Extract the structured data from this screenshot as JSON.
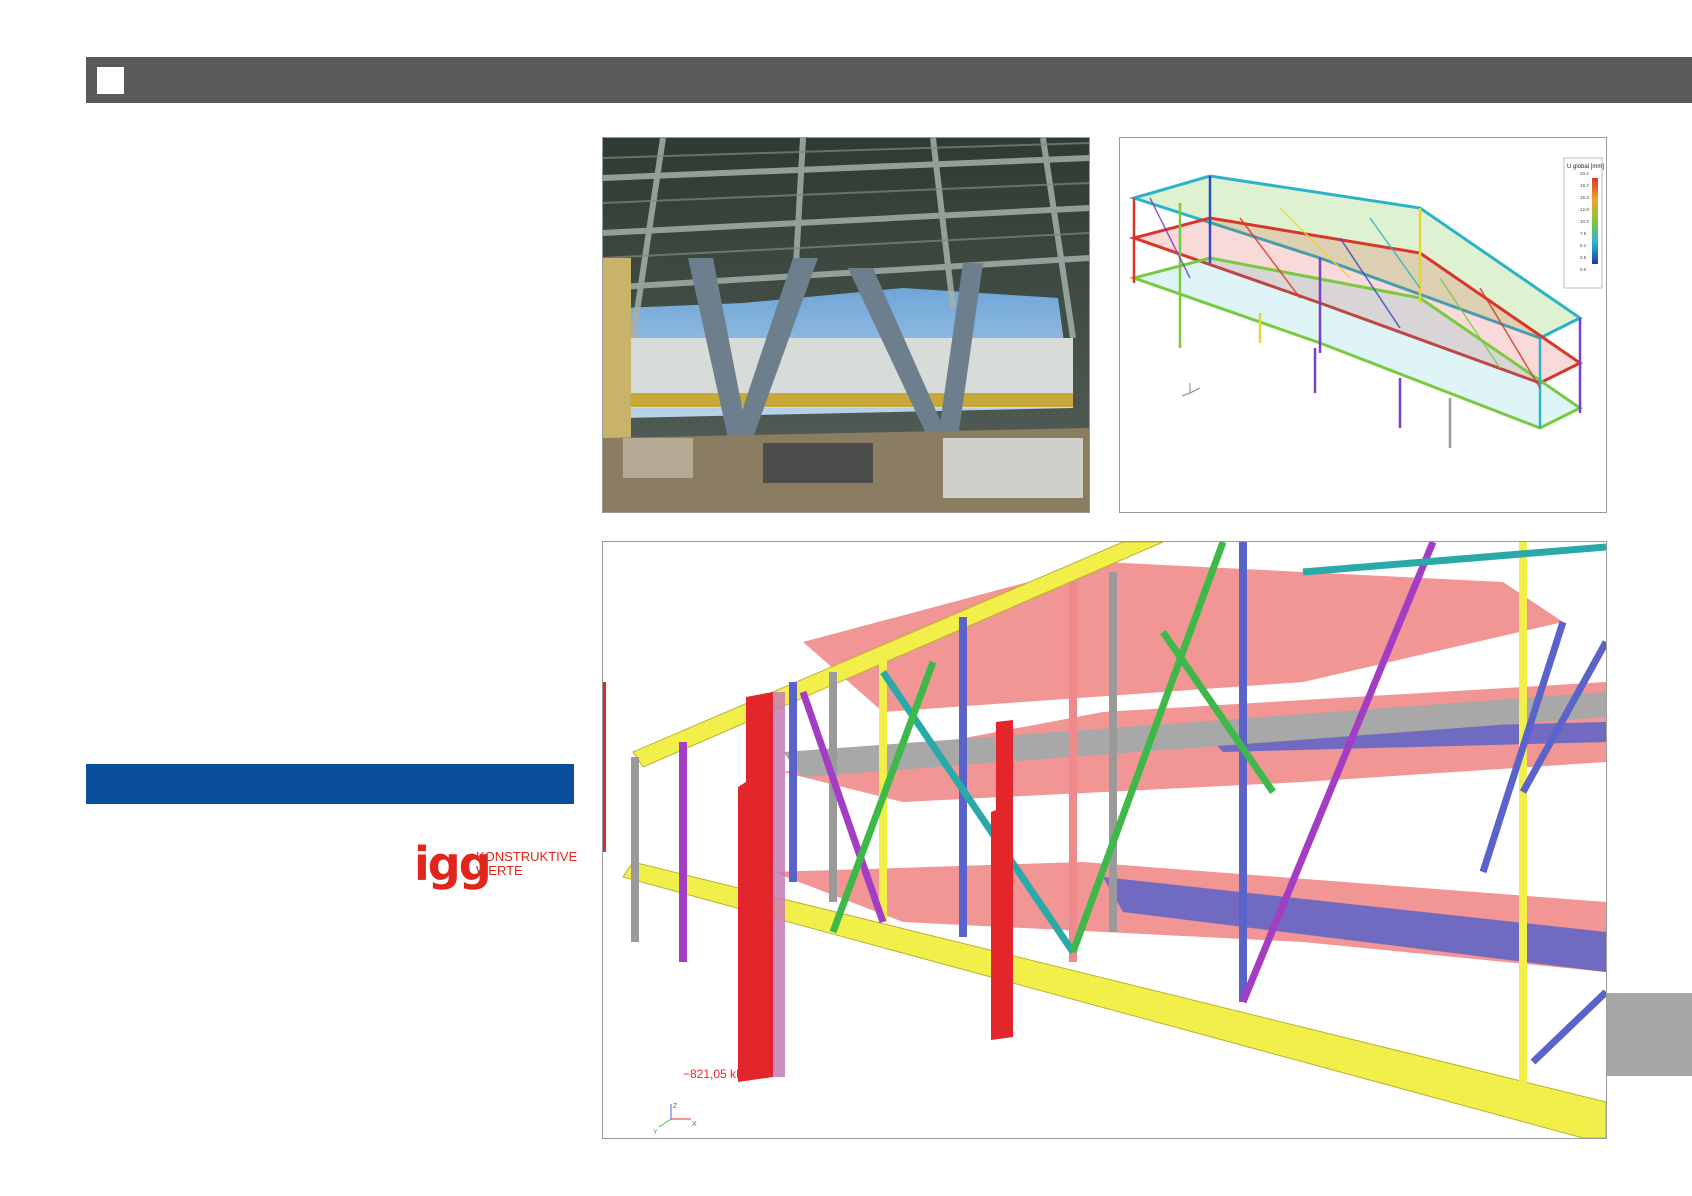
{
  "logo": {
    "mark": "igg",
    "line1": "KONSTRUKTIVE",
    "line2": "WERTE",
    "color": "#e1251b"
  },
  "colors": {
    "header_bar": "#5a5a5a",
    "accent_blue": "#0a4f9e",
    "side_tab": "#a7a7a7"
  },
  "figures": {
    "photo": {
      "description_icon": "construction-photo"
    },
    "model_small": {
      "legend_title": "U global [mm]",
      "legend_values": [
        "20.4",
        "18.3",
        "15.3",
        "12.8",
        "10.2",
        "7.6",
        "5.1",
        "2.5",
        "0.0"
      ]
    },
    "model_large": {
      "force_label": "−821,05 kN",
      "axis_z": "Z",
      "axis_x": "X",
      "axis_y": "Y"
    }
  }
}
